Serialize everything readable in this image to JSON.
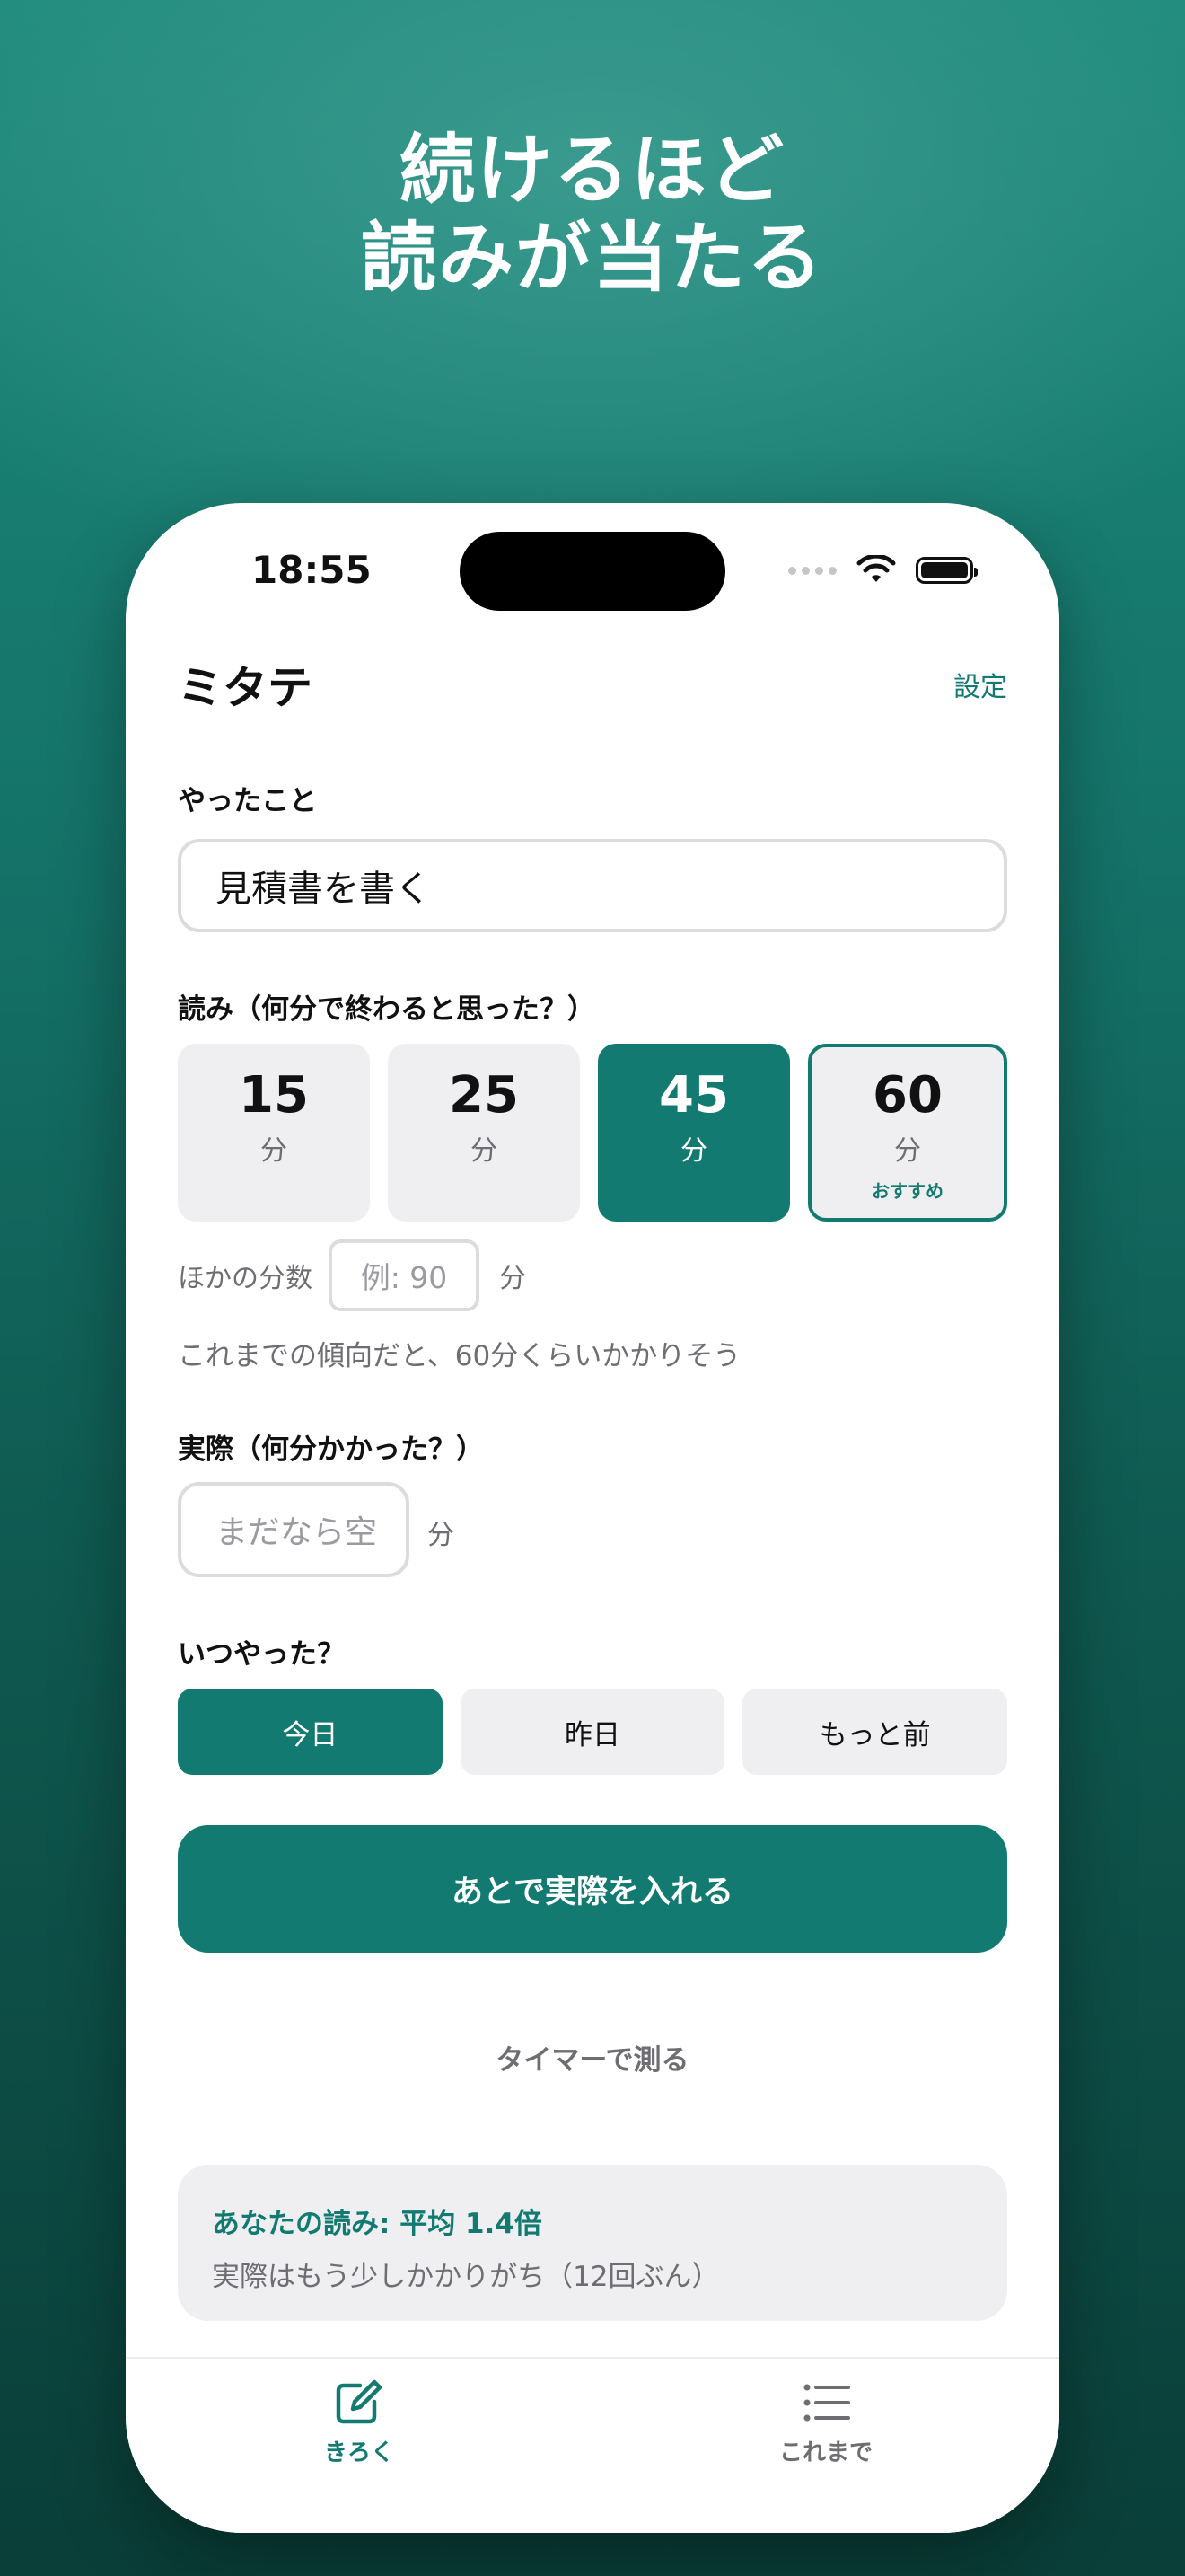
{
  "headline": {
    "line1": "続けるほど",
    "line2": "読みが当たる"
  },
  "status_bar": {
    "time": "18:55"
  },
  "header": {
    "app_title": "ミタテ",
    "settings": "設定"
  },
  "task": {
    "label": "やったこと",
    "value": "見積書を書く"
  },
  "estimate": {
    "label": "読み（何分で終わると思った？）",
    "options": [
      {
        "value": "15",
        "unit": "分"
      },
      {
        "value": "25",
        "unit": "分"
      },
      {
        "value": "45",
        "unit": "分"
      },
      {
        "value": "60",
        "unit": "分",
        "badge": "おすすめ"
      }
    ],
    "selected": "45",
    "other_label": "ほかの分数",
    "other_placeholder": "例: 90",
    "other_unit": "分",
    "trend_text": "これまでの傾向だと、60分くらいかかりそう"
  },
  "actual": {
    "label": "実際（何分かかった？）",
    "placeholder": "まだなら空",
    "unit": "分"
  },
  "when": {
    "label": "いつやった？",
    "options": [
      "今日",
      "昨日",
      "もっと前"
    ],
    "selected": "今日"
  },
  "primary_button": "あとで実際を入れる",
  "timer_link": "タイマーで測る",
  "insight": {
    "title": "あなたの読み: 平均 1.4倍",
    "subtitle": "実際はもう少しかかりがち（12回ぶん）"
  },
  "tabbar": {
    "record": "きろく",
    "history": "これまで"
  },
  "colors": {
    "accent": "#127a70",
    "background_top": "#1e8a7c",
    "background_bottom": "#0a3e38"
  },
  "icons": {
    "record_tab": "pencil-square-icon",
    "history_tab": "list-icon",
    "wifi": "wifi-icon",
    "battery": "battery-icon"
  }
}
